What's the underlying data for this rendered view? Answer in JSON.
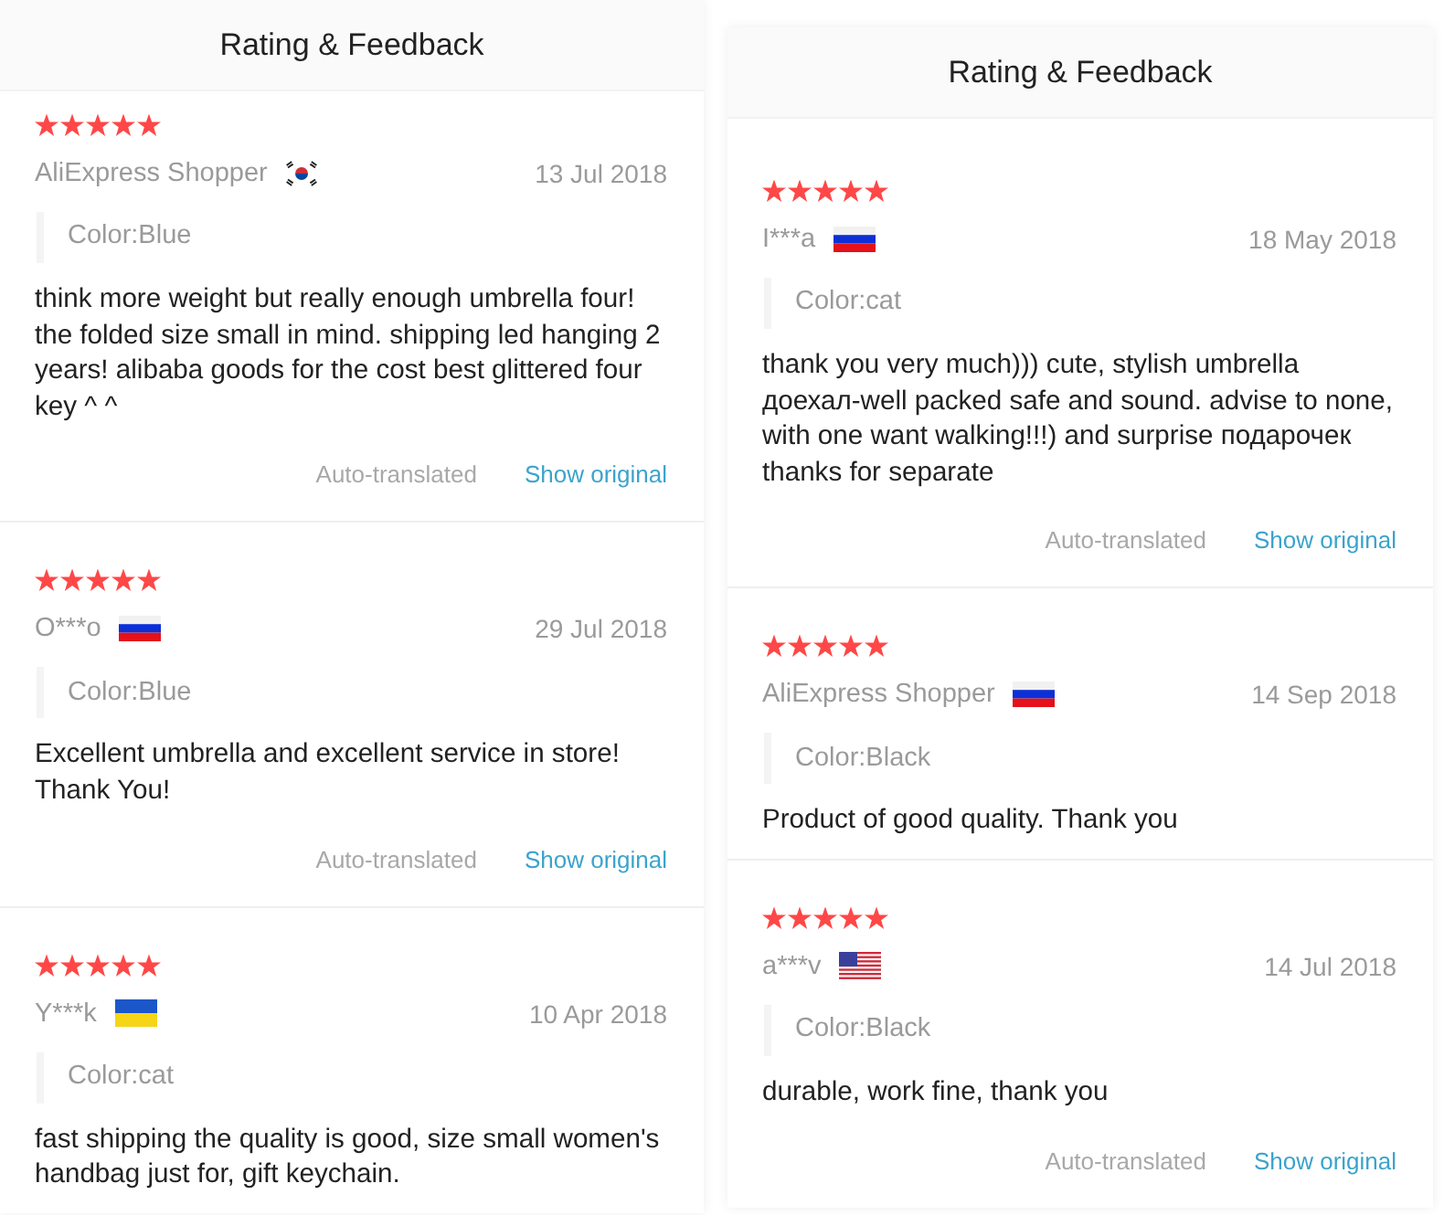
{
  "panels": [
    {
      "title": "Rating & Feedback",
      "reviews": [
        {
          "stars": 5,
          "author": "AliExpress Shopper",
          "flag": {
            "kind": "kr"
          },
          "date": "13 Jul 2018",
          "option": "Color:Blue",
          "text": "think more weight but really enough umbrella four! the folded size small in mind. shipping led hanging 2 years! alibaba goods for the cost best glittered four key ^ ^",
          "translation_note": "Auto-translated",
          "link": "Show original"
        },
        {
          "stars": 5,
          "author": "O***o",
          "flag": {
            "kind": "ru"
          },
          "date": "29 Jul 2018",
          "option": "Color:Blue",
          "text": "Excellent umbrella and excellent service in store! Thank You!",
          "translation_note": "Auto-translated",
          "link": "Show original"
        },
        {
          "stars": 5,
          "author": "Y***k",
          "flag": {
            "kind": "ua"
          },
          "date": "10 Apr 2018",
          "option": "Color:cat",
          "text": "fast shipping the quality is good, size small women's handbag just for, gift keychain."
        }
      ]
    },
    {
      "title": "Rating & Feedback",
      "reviews": [
        {
          "stars": 5,
          "author": "I***a",
          "flag": {
            "kind": "ru"
          },
          "date": "18 May 2018",
          "option": "Color:cat",
          "text": "thank you very much))) cute, stylish umbrella доехал-well packed safe and sound. advise to none, with one want walking!!!) and surprise подарочек thanks for separate",
          "translation_note": "Auto-translated",
          "link": "Show original"
        },
        {
          "stars": 5,
          "author": "AliExpress Shopper",
          "flag": {
            "kind": "ru"
          },
          "date": "14 Sep 2018",
          "option": "Color:Black",
          "text": "Product of good quality. Thank you"
        },
        {
          "stars": 5,
          "author": "a***v",
          "flag": {
            "kind": "us"
          },
          "date": "14 Jul 2018",
          "option": "Color:Black",
          "text": "durable, work fine, thank you",
          "translation_note": "Auto-translated",
          "link": "Show original"
        }
      ]
    }
  ]
}
